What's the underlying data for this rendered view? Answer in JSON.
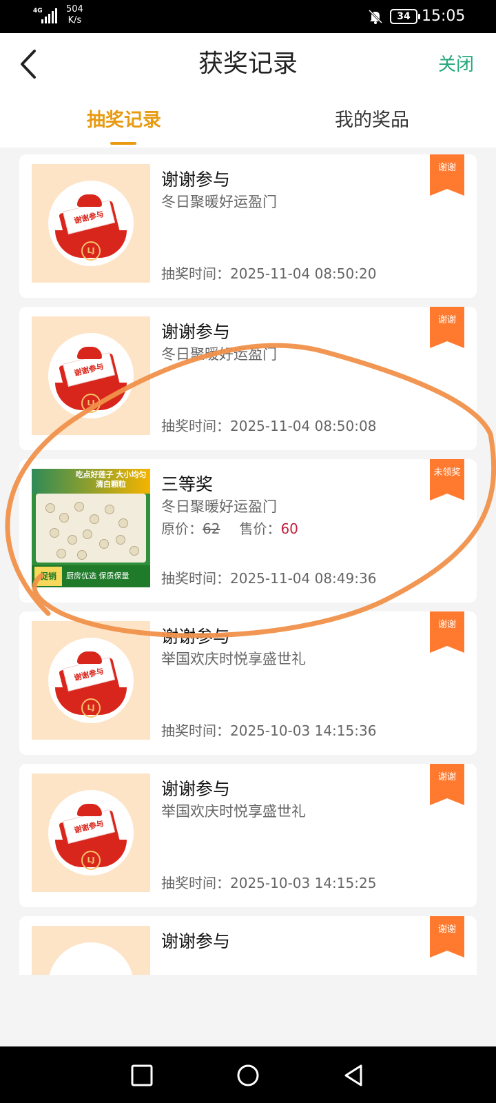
{
  "status_bar": {
    "network": "4G",
    "speed_value": "504",
    "speed_unit": "K/s",
    "battery": "34",
    "time": "15:05"
  },
  "header": {
    "title": "获奖记录",
    "close_label": "关闭"
  },
  "tabs": [
    {
      "label": "抽奖记录",
      "active": true
    },
    {
      "label": "我的奖品",
      "active": false
    }
  ],
  "records": [
    {
      "title": "谢谢参与",
      "activity": "冬日聚暖好运盈门",
      "badge": "谢谢",
      "time_label": "抽奖时间：",
      "time": "2025-11-04 08:50:20",
      "image": "thanks-icon"
    },
    {
      "title": "谢谢参与",
      "activity": "冬日聚暖好运盈门",
      "badge": "谢谢",
      "time_label": "抽奖时间：",
      "time": "2025-11-04 08:50:08",
      "image": "thanks-icon"
    },
    {
      "title": "三等奖",
      "activity": "冬日聚暖好运盈门",
      "badge": "未领奖",
      "time_label": "抽奖时间：",
      "time": "2025-11-04 08:49:36",
      "image": "lotus-seed-product",
      "orig_price_label": "原价：",
      "orig_price": "62",
      "sale_price_label": "售价：",
      "sale_price": "60",
      "product_image_text": {
        "headline": "吃点好莲子 大小均匀 清白颗粒",
        "promo": "促销",
        "footer": "厨房优选 保质保量"
      }
    },
    {
      "title": "谢谢参与",
      "activity": "举国欢庆时悦享盛世礼",
      "badge": "谢谢",
      "time_label": "抽奖时间：",
      "time": "2025-10-03 14:15:36",
      "image": "thanks-icon"
    },
    {
      "title": "谢谢参与",
      "activity": "举国欢庆时悦享盛世礼",
      "badge": "谢谢",
      "time_label": "抽奖时间：",
      "time": "2025-10-03 14:15:25",
      "image": "thanks-icon"
    },
    {
      "title": "谢谢参与",
      "activity": "",
      "badge": "谢谢",
      "time_label": "",
      "time": "",
      "image": "thanks-icon"
    }
  ],
  "thanks_image_text": {
    "tag": "谢谢参与",
    "logo": "LJ"
  },
  "colors": {
    "accent_tab": "#e89b12",
    "close_text": "#21a87b",
    "ribbon": "#ff7a2e",
    "sale_price": "#c41e3a",
    "annotation_stroke": "#f0914a"
  },
  "nav": {
    "recent": "square-icon",
    "home": "circle-icon",
    "back": "triangle-back-icon"
  }
}
